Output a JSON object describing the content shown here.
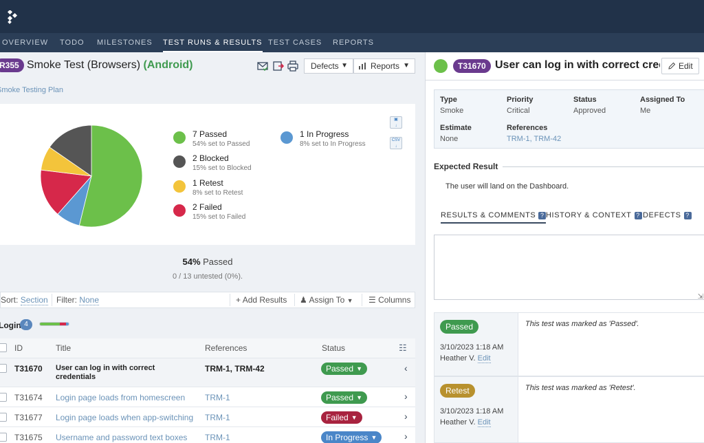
{
  "nav": {
    "items": [
      {
        "label": "OVERVIEW",
        "active": false
      },
      {
        "label": "TODO",
        "active": false
      },
      {
        "label": "MILESTONES",
        "active": false
      },
      {
        "label": "TEST RUNS & RESULTS",
        "active": true
      },
      {
        "label": "TEST CASES",
        "active": false
      },
      {
        "label": "REPORTS",
        "active": false
      }
    ]
  },
  "run": {
    "id": "R355",
    "title": "Smoke Test (Browsers)",
    "tag": "(Android)",
    "plan_link": "Smoke Testing Plan",
    "defects_label": "Defects",
    "reports_label": "Reports"
  },
  "colors": {
    "passed": "#6cc04a",
    "blocked": "#555555",
    "retest": "#f3c43b",
    "failed": "#d6284a",
    "in_progress": "#5b98d2"
  },
  "chart_data": {
    "type": "pie",
    "slices": [
      {
        "label": "Passed",
        "value": 7,
        "color": "#6cc04a"
      },
      {
        "label": "In Progress",
        "value": 1,
        "color": "#5b98d2"
      },
      {
        "label": "Failed",
        "value": 2,
        "color": "#d6284a"
      },
      {
        "label": "Retest",
        "value": 1,
        "color": "#f3c43b"
      },
      {
        "label": "Blocked",
        "value": 2,
        "color": "#555555"
      }
    ],
    "legend": [
      {
        "main": "7 Passed",
        "sub": "54% set to Passed",
        "color": "#6cc04a"
      },
      {
        "main": "2 Blocked",
        "sub": "15% set to Blocked",
        "color": "#555555"
      },
      {
        "main": "1 Retest",
        "sub": "8% set to Retest",
        "color": "#f3c43b"
      },
      {
        "main": "2 Failed",
        "sub": "15% set to Failed",
        "color": "#d6284a"
      },
      {
        "main": "1 In Progress",
        "sub": "8% set to In Progress",
        "color": "#5b98d2"
      }
    ]
  },
  "summary": {
    "percent": "54%",
    "passed_word": "Passed",
    "untested": "0 / 13 untested (0%)."
  },
  "toolbar": {
    "sort_label": "Sort:",
    "sort_value": "Section",
    "filter_label": "Filter:",
    "filter_value": "None",
    "add_results": "Add Results",
    "assign_to": "Assign To",
    "columns": "Columns"
  },
  "section": {
    "title": "Login",
    "count": "4"
  },
  "table": {
    "headers": {
      "id": "ID",
      "title": "Title",
      "references": "References",
      "status": "Status"
    },
    "rows": [
      {
        "id": "T31670",
        "title_line1": "User can log in with correct",
        "title_line2": "credentials",
        "refs": "TRM-1, TRM-42",
        "status": "Passed",
        "status_color": "#3f9a4f",
        "selected": true
      },
      {
        "id": "T31674",
        "title_line1": "Login page loads from homescreen",
        "title_line2": "",
        "refs": "TRM-1",
        "status": "Passed",
        "status_color": "#3f9a4f",
        "selected": false
      },
      {
        "id": "T31677",
        "title_line1": "Login page loads when app-switching",
        "title_line2": "",
        "refs": "TRM-1",
        "status": "Failed",
        "status_color": "#a8233f",
        "selected": false
      },
      {
        "id": "T31675",
        "title_line1": "Username and password text boxes",
        "title_line2": "",
        "refs": "TRM-1",
        "status": "In Progress",
        "status_color": "#4a86c8",
        "selected": false
      }
    ]
  },
  "detail": {
    "id": "T31670",
    "title": "User can log in with correct credentials",
    "edit_label": "Edit",
    "props": {
      "type_label": "Type",
      "type_value": "Smoke",
      "priority_label": "Priority",
      "priority_value": "Critical",
      "status_label": "Status",
      "status_value": "Approved",
      "assigned_label": "Assigned To",
      "assigned_value": "Me",
      "estimate_label": "Estimate",
      "estimate_value": "None",
      "references_label": "References",
      "references_value": "TRM-1, TRM-42"
    },
    "expected_label": "Expected Result",
    "expected_text": "The user will land on the Dashboard.",
    "tabs": [
      {
        "label": "RESULTS & COMMENTS",
        "active": true
      },
      {
        "label": "HISTORY & CONTEXT",
        "active": false
      },
      {
        "label": "DEFECTS",
        "active": false
      }
    ],
    "results": [
      {
        "status": "Passed",
        "color": "#3f9a4f",
        "date": "3/10/2023 1:18 AM",
        "user": "Heather V.",
        "edit": "Edit",
        "comment": "This test was marked as 'Passed'."
      },
      {
        "status": "Retest",
        "color": "#b8912e",
        "date": "3/10/2023 1:18 AM",
        "user": "Heather V.",
        "edit": "Edit",
        "comment": "This test was marked as 'Retest'."
      }
    ]
  }
}
